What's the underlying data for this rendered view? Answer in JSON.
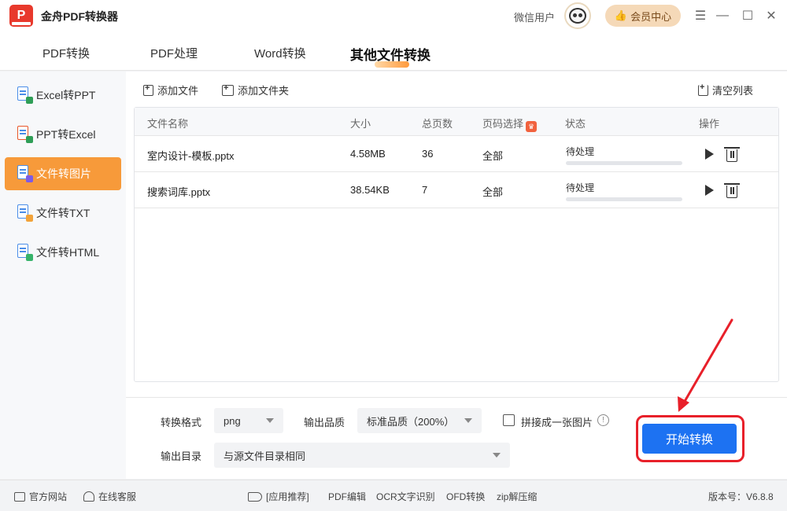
{
  "app": {
    "title": "金舟PDF转换器",
    "user_name": "微信用户",
    "vip_label": "会员中心"
  },
  "window_controls": [
    "☰",
    "—",
    "☐",
    "✕"
  ],
  "top_tabs": [
    {
      "label": "PDF转换",
      "active": false
    },
    {
      "label": "PDF处理",
      "active": false
    },
    {
      "label": "Word转换",
      "active": false
    },
    {
      "label": "其他文件转换",
      "active": true
    }
  ],
  "sidebar": {
    "items": [
      {
        "label": "Excel转PPT",
        "active": false,
        "badge_color": "#2f9e57"
      },
      {
        "label": "PPT转Excel",
        "active": false,
        "badge_color": "#e8572a"
      },
      {
        "label": "文件转图片",
        "active": true,
        "badge_color": "#7c5be6"
      },
      {
        "label": "文件转TXT",
        "active": false,
        "badge_color": "#f2a33a"
      },
      {
        "label": "文件转HTML",
        "active": false,
        "badge_color": "#37b36a"
      }
    ]
  },
  "toolbar": {
    "add_file": "添加文件",
    "add_folder": "添加文件夹",
    "clear_list": "清空列表"
  },
  "table": {
    "headers": {
      "name": "文件名称",
      "size": "大小",
      "pages": "总页数",
      "page_select": "页码选择",
      "status": "状态",
      "actions": "操作"
    },
    "rows": [
      {
        "name": "室内设计-模板.pptx",
        "size": "4.58MB",
        "pages": "36",
        "page_select": "全部",
        "status": "待处理",
        "progress": 0
      },
      {
        "name": "搜索词库.pptx",
        "size": "38.54KB",
        "pages": "7",
        "page_select": "全部",
        "status": "待处理",
        "progress": 0
      }
    ]
  },
  "settings": {
    "format_label": "转换格式",
    "format_value": "png",
    "quality_label": "输出品质",
    "quality_value": "标准品质（200%）",
    "merge_label": "拼接成一张图片",
    "merge_checked": false,
    "output_label": "输出目录",
    "output_value": "与源文件目录相同",
    "start_button": "开始转换"
  },
  "footer": {
    "website": "官方网站",
    "support": "在线客服",
    "recommend": "[应用推荐]",
    "links": [
      "PDF编辑",
      "OCR文字识别",
      "OFD转换",
      "zip解压缩"
    ],
    "version": "版本号：V6.8.8"
  },
  "colors": {
    "accent_orange": "#f79a3a",
    "primary_blue": "#1d72f2",
    "highlight_red": "#e8202a"
  }
}
